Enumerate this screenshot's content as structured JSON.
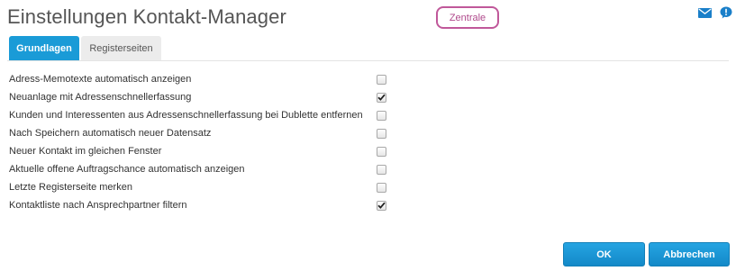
{
  "header": {
    "title": "Einstellungen Kontakt-Manager",
    "zentrale_label": "Zentrale",
    "mail_icon": "mail-icon",
    "help_icon": "help-icon",
    "accent_color": "#1a9bd7",
    "zentrale_color": "#c0589a"
  },
  "tabs": [
    {
      "label": "Grundlagen",
      "active": true
    },
    {
      "label": "Registerseiten",
      "active": false
    }
  ],
  "options": [
    {
      "label": "Adress-Memotexte automatisch anzeigen",
      "checked": false
    },
    {
      "label": "Neuanlage mit Adressenschnellerfassung",
      "checked": true
    },
    {
      "label": "Kunden und Interessenten aus Adressenschnellerfassung bei Dublette entfernen",
      "checked": false
    },
    {
      "label": "Nach Speichern automatisch neuer Datensatz",
      "checked": false
    },
    {
      "label": "Neuer Kontakt im gleichen Fenster",
      "checked": false
    },
    {
      "label": "Aktuelle offene Auftragschance automatisch anzeigen",
      "checked": false
    },
    {
      "label": "Letzte Registerseite merken",
      "checked": false
    },
    {
      "label": "Kontaktliste nach Ansprechpartner filtern",
      "checked": true
    }
  ],
  "footer": {
    "ok_label": "OK",
    "cancel_label": "Abbrechen"
  }
}
